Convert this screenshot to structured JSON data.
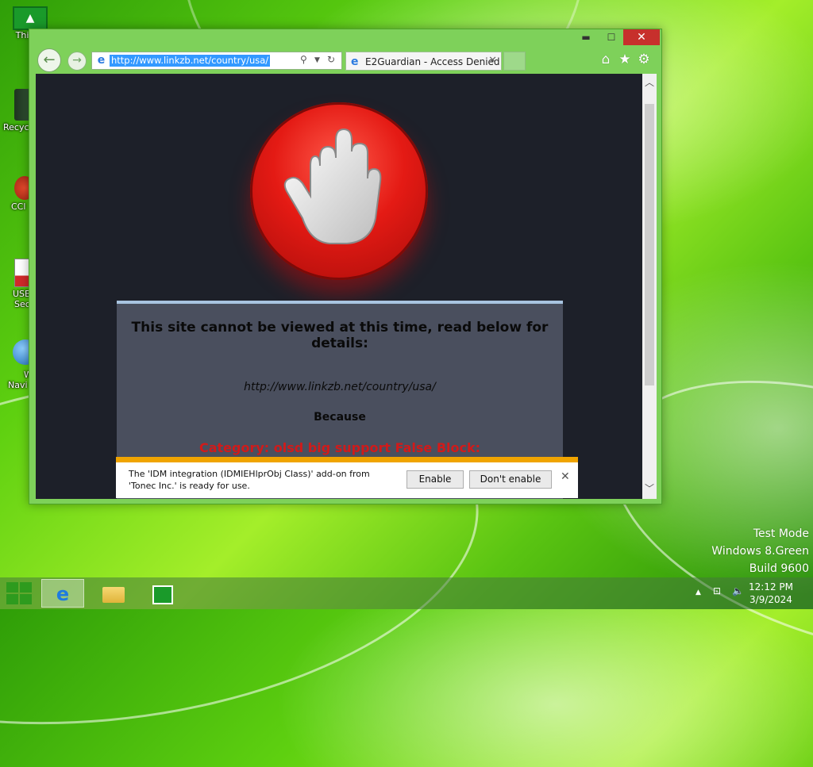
{
  "desktop": {
    "icons": [
      {
        "label": "Thi"
      },
      {
        "label": "Recyc"
      },
      {
        "label": "CCl"
      },
      {
        "label": "USB",
        "label2": "Sec"
      },
      {
        "label": "W",
        "label2": "Navi"
      }
    ],
    "watermark": {
      "line1": "Test Mode",
      "line2": "Windows 8.Green",
      "line3": "Build 9600"
    }
  },
  "browser": {
    "caption": {
      "minimize": "▬",
      "maximize": "☐",
      "close": "✕"
    },
    "address": {
      "url": "http://www.linkzb.net/country/usa/",
      "search_icon": "search-icon",
      "refresh_icon": "refresh-icon"
    },
    "tab": {
      "title": "E2Guardian - Access Denied",
      "close": "✕"
    },
    "toolbar_icons": [
      "home-icon",
      "favorites-star-icon",
      "gear-icon"
    ]
  },
  "page": {
    "headline": "This site cannot be viewed at this time, read below for details:",
    "blocked_url": "http://www.linkzb.net/country/usa/",
    "because": "Because",
    "reason": "Category: olsd big support False Block:"
  },
  "notification": {
    "message": "The 'IDM integration (IDMIEHlprObj Class)' add-on from 'Tonec Inc.' is ready for use.",
    "enable_label": "Enable",
    "dont_enable_label": "Don't enable",
    "close": "✕"
  },
  "taskbar": {
    "apps": [
      "internet-explorer-icon",
      "file-explorer-icon",
      "store-icon"
    ],
    "clock": {
      "time": "12:12 PM",
      "date": "3/9/2024"
    },
    "colors": {
      "accent": "#7ed15a",
      "close": "#c7302c",
      "notif_bar": "#f0a400",
      "reason": "#d11a1a"
    }
  }
}
